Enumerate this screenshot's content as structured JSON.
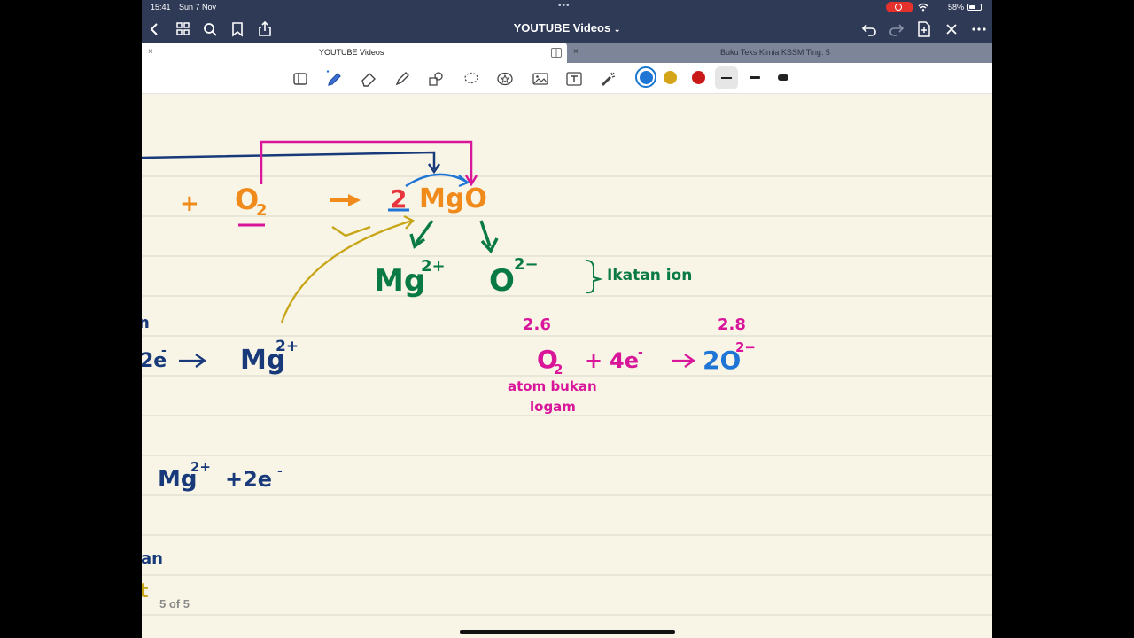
{
  "status_bar": {
    "time": "15:41",
    "date": "Sun 7 Nov",
    "battery": "58%",
    "battery_level": 0.58
  },
  "nav": {
    "document_title": "YOUTUBE Videos",
    "title_chevron": "chevron-down-icon"
  },
  "tabs": [
    {
      "label": "YOUTUBE Videos",
      "active": true
    },
    {
      "label": "Buku Teks Kimia KSSM Ting. 5",
      "active": false
    }
  ],
  "toolbar": {
    "tools": [
      "sidebar-icon",
      "pen-icon",
      "eraser-icon",
      "highlighter-icon",
      "shapes-icon",
      "lasso-icon",
      "sticker-icon",
      "image-icon",
      "text-icon",
      "laser-pointer-icon"
    ],
    "colors": [
      "#1f75d6",
      "#d4a518",
      "#c91818"
    ],
    "selected_color": "#1f75d6"
  },
  "page_indicator": "5 of 5",
  "notes": {
    "eq_plus": "+",
    "o2": "O",
    "o2_sub": "2",
    "coef": "2",
    "mgo": "MgO",
    "mg_ion": "Mg",
    "mg_ion_charge": "2+",
    "o_ion": "O",
    "o_ion_charge": "2−",
    "ikatan_ion": "Ikatan ion",
    "left_n": "n",
    "left_2e": "2e",
    "left_2e_sup": "-",
    "mg2plus": "Mg",
    "mg2plus_charge": "2+",
    "config_o": "2.6",
    "config_o2": "2.8",
    "o2_eq": "O",
    "o2_eq_sub": "2",
    "plus_4e": "+",
    "four_e": "4e",
    "four_e_sup": "-",
    "two_o": "2O",
    "two_o_charge": "2−",
    "atom_bukan_logam_1": "atom bukan",
    "atom_bukan_logam_2": "logam",
    "mg_line2": "Mg",
    "mg_line2_charge": "2+",
    "plus_2e": "+2e",
    "plus_2e_sup": "-",
    "an": "an",
    "t": "t"
  }
}
